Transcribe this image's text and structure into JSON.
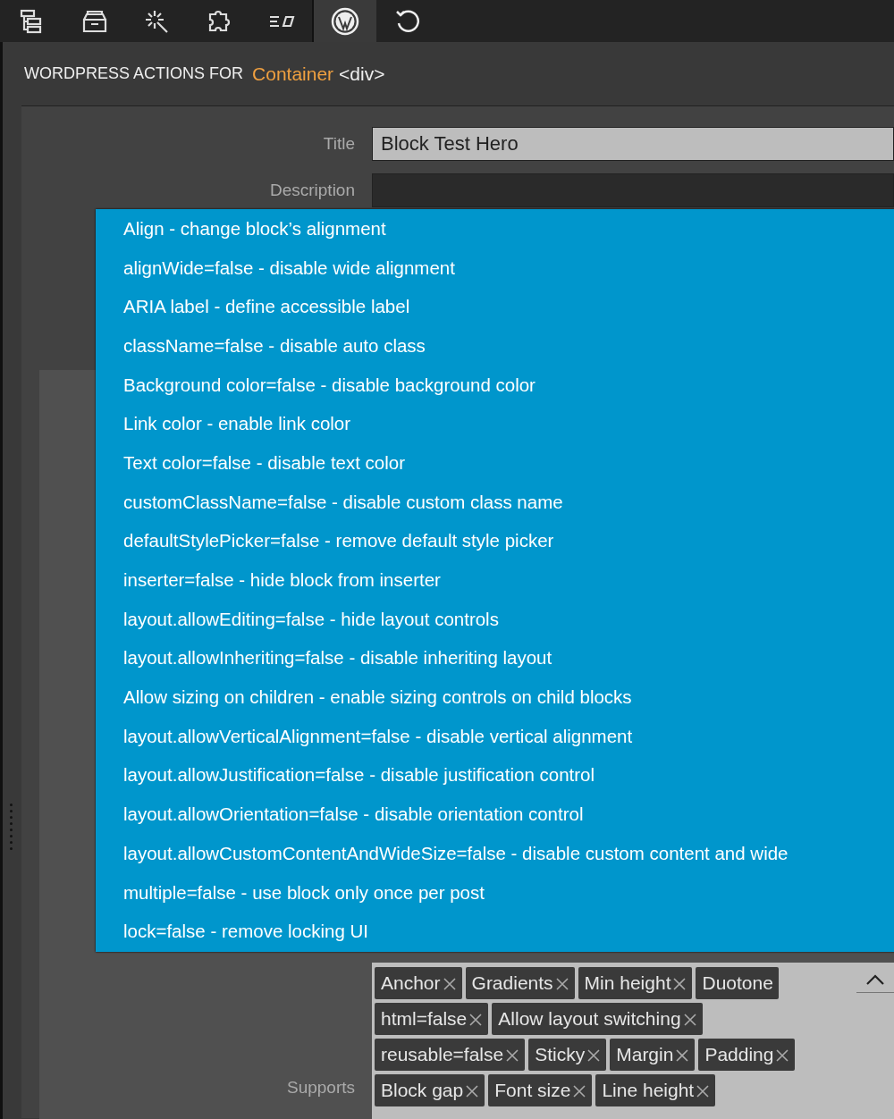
{
  "toolbar": {
    "tabs": [
      {
        "kind": "tree",
        "selected": false
      },
      {
        "kind": "layers",
        "selected": false
      },
      {
        "kind": "magic",
        "selected": false
      },
      {
        "kind": "puzzle",
        "selected": false
      },
      {
        "kind": "text",
        "selected": false
      },
      {
        "kind": "wordpress",
        "selected": true
      },
      {
        "kind": "undo",
        "selected": false
      }
    ]
  },
  "header": {
    "prefix": "WORDPRESS ACTIONS FOR",
    "element": "Container",
    "tag": "<div>"
  },
  "form": {
    "title_label": "Title",
    "title_value": "Block Test Hero",
    "description_label": "Description"
  },
  "dropdown": {
    "options": [
      "Align - change block’s alignment",
      "alignWide=false - disable wide alignment",
      "ARIA label - define accessible label",
      "className=false - disable auto class",
      "Background color=false - disable background color",
      "Link color - enable link color",
      "Text color=false - disable text color",
      "customClassName=false - disable custom class name",
      "defaultStylePicker=false - remove default style picker",
      "inserter=false - hide block from inserter",
      "layout.allowEditing=false - hide layout controls",
      "layout.allowInheriting=false - disable inheriting layout",
      "Allow sizing on children - enable sizing controls on child blocks",
      "layout.allowVerticalAlignment=false - disable vertical alignment",
      "layout.allowJustification=false - disable justification control",
      "layout.allowOrientation=false - disable orientation control",
      "layout.allowCustomContentAndWideSize=false - disable custom content and wide",
      "multiple=false - use block only once per post",
      "lock=false - remove locking UI"
    ]
  },
  "supports": {
    "label": "Supports",
    "rows": [
      [
        {
          "label": "Anchor",
          "removable": true
        },
        {
          "label": "Gradients",
          "removable": true
        },
        {
          "label": "Min height",
          "removable": true
        },
        {
          "label": "Duotone",
          "removable": false
        }
      ],
      [
        {
          "label": "html=false",
          "removable": true
        },
        {
          "label": "Allow layout switching",
          "removable": true
        }
      ],
      [
        {
          "label": "reusable=false",
          "removable": true
        },
        {
          "label": "Sticky",
          "removable": true
        },
        {
          "label": "Margin",
          "removable": true
        },
        {
          "label": "Padding",
          "removable": true
        }
      ],
      [
        {
          "label": "Block gap",
          "removable": true
        },
        {
          "label": "Font size",
          "removable": true
        },
        {
          "label": "Line height",
          "removable": true
        }
      ]
    ]
  }
}
